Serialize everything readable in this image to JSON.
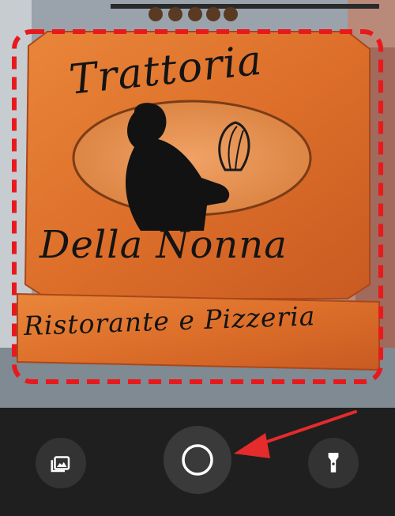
{
  "sign": {
    "line1": "Trattoria",
    "line2": "Della Nonna",
    "line3": "Ristorante e Pizzeria"
  },
  "toolbar": {
    "left_icon": "gallery-icon",
    "center_icon": "shutter-icon",
    "right_icon": "flashlight-icon"
  },
  "colors": {
    "sign_orange": "#e07a2e",
    "crop_border": "#e8191c",
    "toolbar_bg": "#1f1f1f",
    "button_bg": "#333333",
    "arrow": "#e52b2b"
  }
}
